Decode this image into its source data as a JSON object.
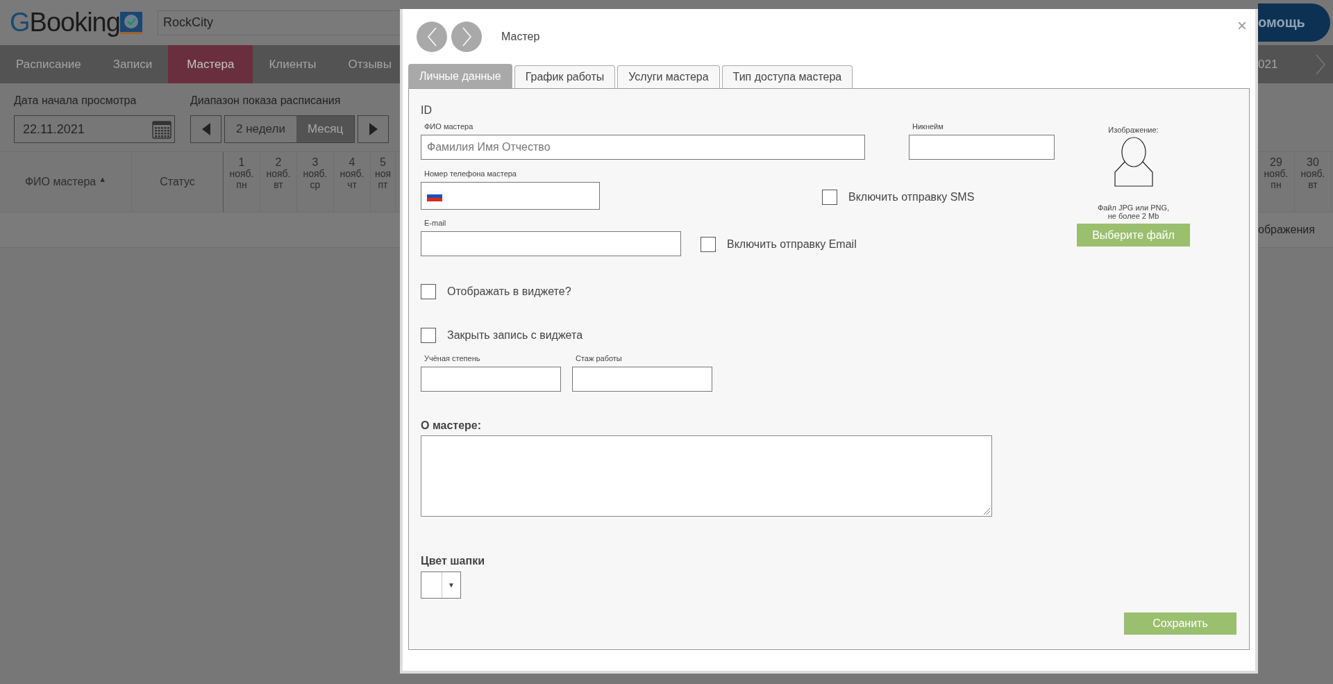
{
  "header": {
    "logo": "GBooking",
    "search_value": "RockCity",
    "help_button": "омощь"
  },
  "nav": {
    "tabs": [
      {
        "label": "Расписание",
        "selected": false
      },
      {
        "label": "Записи",
        "selected": false
      },
      {
        "label": "Мастера",
        "selected": true
      },
      {
        "label": "Клиенты",
        "selected": false
      },
      {
        "label": "Отзывы",
        "selected": false
      }
    ],
    "right_text": "021"
  },
  "controls": {
    "date_label": "Дата начала просмотра",
    "date_value": "22.11.2021",
    "range_label": "Диапазон показа расписания",
    "range_options": [
      {
        "label": "2 недели",
        "selected": false
      },
      {
        "label": "Месяц",
        "selected": true
      }
    ]
  },
  "table": {
    "name_column": "ФИО мастера",
    "sort_mark": "▲",
    "status_column": "Статус",
    "days_left": [
      {
        "day": "1",
        "month": "нояб.",
        "weekday": "пн"
      },
      {
        "day": "2",
        "month": "нояб.",
        "weekday": "вт"
      },
      {
        "day": "3",
        "month": "нояб.",
        "weekday": "ср"
      },
      {
        "day": "4",
        "month": "нояб.",
        "weekday": "чт"
      },
      {
        "day": "5",
        "month": "ноя",
        "weekday": "пт"
      }
    ],
    "days_right": [
      {
        "day": "29",
        "month": "нояб.",
        "weekday": "пн"
      },
      {
        "day": "30",
        "month": "нояб.",
        "weekday": "вт"
      }
    ],
    "row_text": "ображения"
  },
  "modal": {
    "title": "Мастер",
    "close": "×",
    "tabs": [
      {
        "label": "Личные данные",
        "selected": true
      },
      {
        "label": "График работы",
        "selected": false
      },
      {
        "label": "Услуги мастера",
        "selected": false
      },
      {
        "label": "Тип доступа мастера",
        "selected": false
      }
    ],
    "id_label": "ID",
    "full_name": {
      "label": "ФИО мастера",
      "placeholder": "Фамилия Имя Отчество"
    },
    "nickname": {
      "label": "Никнейм"
    },
    "image": {
      "label": "Изображение:",
      "note": "Файл JPG или PNG,\nне более 2 Mb",
      "button": "Выберите файл"
    },
    "phone": {
      "label": "Номер телефона мастера"
    },
    "sms": {
      "label": "Включить отправку SMS",
      "checked": false
    },
    "email": {
      "label": "E-mail"
    },
    "email_notify": {
      "label": "Включить отправку Email",
      "checked": false
    },
    "show_in_widget": {
      "label": "Отображать в виджете?",
      "checked": false
    },
    "close_booking": {
      "label": "Закрыть запись с виджета",
      "checked": false
    },
    "degree": {
      "label": "Учёная степень"
    },
    "experience": {
      "label": "Стаж работы"
    },
    "about": {
      "label": "О мастере:"
    },
    "header_color": {
      "label": "Цвет шапки",
      "arrow": "▼"
    },
    "save_button": "Сохранить"
  }
}
